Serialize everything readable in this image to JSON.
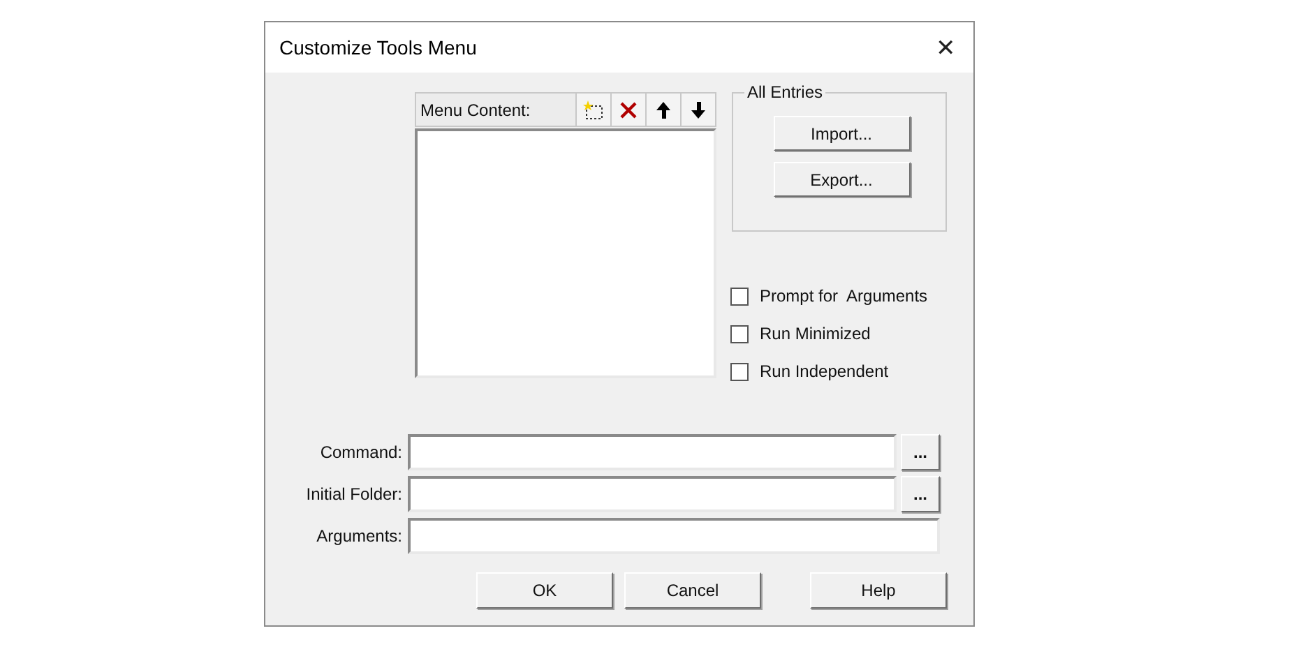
{
  "window": {
    "title": "Customize Tools Menu",
    "close": "✕"
  },
  "menu_content": {
    "label": "Menu Content:",
    "toolbar": [
      {
        "kind": "new"
      },
      {
        "kind": "delete"
      },
      {
        "kind": "up"
      },
      {
        "kind": "down"
      }
    ]
  },
  "all_entries": {
    "title": "All Entries",
    "buttons": [
      "Import...",
      "Export..."
    ]
  },
  "options": [
    {
      "label": "Prompt for  Arguments",
      "checked": false
    },
    {
      "label": "Run Minimized",
      "checked": false
    },
    {
      "label": "Run Independent",
      "checked": false
    }
  ],
  "fields": [
    {
      "label": "Command:",
      "browse": "..."
    },
    {
      "label": "Initial Folder:",
      "browse": "..."
    },
    {
      "label": "Arguments:"
    }
  ],
  "buttons": [
    "OK",
    "Cancel",
    "Help"
  ]
}
